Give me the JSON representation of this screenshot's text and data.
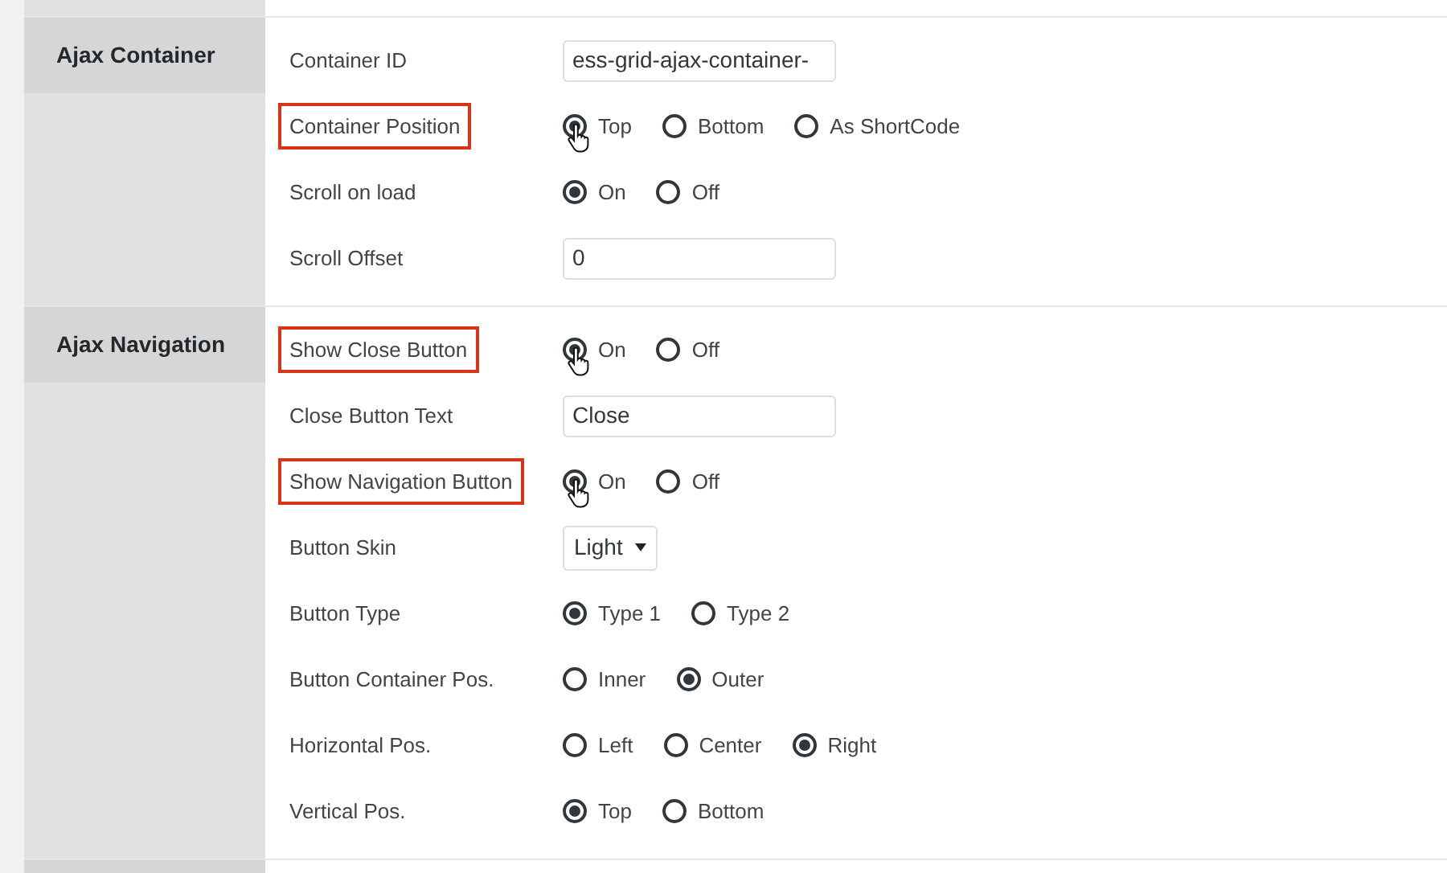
{
  "sections": [
    {
      "title": "Ajax Container",
      "rows": [
        {
          "label": "Container ID",
          "kind": "text",
          "value": "ess-grid-ajax-container-",
          "highlighted": false
        },
        {
          "label": "Container Position",
          "kind": "radio",
          "highlighted": true,
          "pointer": true,
          "options": [
            {
              "label": "Top",
              "selected": true
            },
            {
              "label": "Bottom",
              "selected": false
            },
            {
              "label": "As ShortCode",
              "selected": false
            }
          ]
        },
        {
          "label": "Scroll on load",
          "kind": "radio",
          "highlighted": false,
          "pointer": false,
          "options": [
            {
              "label": "On",
              "selected": true
            },
            {
              "label": "Off",
              "selected": false
            }
          ]
        },
        {
          "label": "Scroll Offset",
          "kind": "text",
          "value": "0",
          "highlighted": false
        }
      ]
    },
    {
      "title": "Ajax Navigation",
      "rows": [
        {
          "label": "Show Close Button",
          "kind": "radio",
          "highlighted": true,
          "pointer": true,
          "options": [
            {
              "label": "On",
              "selected": true
            },
            {
              "label": "Off",
              "selected": false
            }
          ]
        },
        {
          "label": "Close Button Text",
          "kind": "text",
          "value": "Close",
          "highlighted": false
        },
        {
          "label": "Show Navigation Button",
          "kind": "radio",
          "highlighted": true,
          "pointer": true,
          "options": [
            {
              "label": "On",
              "selected": true
            },
            {
              "label": "Off",
              "selected": false
            }
          ]
        },
        {
          "label": "Button Skin",
          "kind": "select",
          "value": "Light",
          "highlighted": false
        },
        {
          "label": "Button Type",
          "kind": "radio",
          "highlighted": false,
          "pointer": false,
          "options": [
            {
              "label": "Type 1",
              "selected": true
            },
            {
              "label": "Type 2",
              "selected": false
            }
          ]
        },
        {
          "label": "Button Container Pos.",
          "kind": "radio",
          "highlighted": false,
          "pointer": false,
          "options": [
            {
              "label": "Inner",
              "selected": false
            },
            {
              "label": "Outer",
              "selected": true
            }
          ]
        },
        {
          "label": "Horizontal Pos.",
          "kind": "radio",
          "highlighted": false,
          "pointer": false,
          "options": [
            {
              "label": "Left",
              "selected": false
            },
            {
              "label": "Center",
              "selected": false
            },
            {
              "label": "Right",
              "selected": true
            }
          ]
        },
        {
          "label": "Vertical Pos.",
          "kind": "radio",
          "highlighted": false,
          "pointer": false,
          "options": [
            {
              "label": "Top",
              "selected": true
            },
            {
              "label": "Bottom",
              "selected": false
            }
          ]
        }
      ]
    }
  ]
}
